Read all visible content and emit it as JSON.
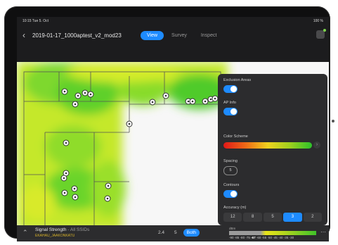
{
  "status_bar": {
    "time": "10:15  Tue 5. Oct",
    "battery": "100 %"
  },
  "nav": {
    "back_icon": "chevron-left-icon",
    "title": "2019-01-17_1000aptest_v2_mod23",
    "tabs": [
      {
        "label": "View",
        "active": true
      },
      {
        "label": "Survey",
        "active": false
      },
      {
        "label": "Inspect",
        "active": false
      }
    ],
    "menu_icon": "sidebar-icon"
  },
  "panel": {
    "exclusion_areas": {
      "label": "Exclusion Areas",
      "on": true
    },
    "ap_info": {
      "label": "AP Info",
      "on": true
    },
    "color_scheme": {
      "label": "Color Scheme",
      "colors": [
        "#e01818",
        "#ef6a17",
        "#f0d21e",
        "#9fd01e",
        "#2cc12a"
      ]
    },
    "spacing": {
      "label": "Spacing",
      "value": "5"
    },
    "contours": {
      "label": "Contours",
      "on": true
    },
    "accuracy": {
      "label": "Accuracy (m)",
      "options": [
        "12",
        "8",
        "5",
        "3",
        "2"
      ],
      "selected": "3"
    }
  },
  "bottom": {
    "title": "Signal Strength",
    "subtitle": " - All SSIDs",
    "ssid": "EKAHAU_JAAKONKATU",
    "bands": [
      {
        "label": "2.4",
        "active": false
      },
      {
        "label": "5",
        "active": false
      },
      {
        "label": "Both",
        "active": true
      }
    ],
    "scale_unit": "dBm",
    "scale_values": [
      "-90",
      "-85",
      "-80",
      "-75",
      "-67",
      "-60",
      "-55",
      "-50",
      "-45",
      "-40",
      "-35",
      "-30"
    ],
    "scale_selected": "-67",
    "more_icon": "ellipsis-icon"
  },
  "colors": {
    "accent": "#1e8bff",
    "panel_bg": "#2c2c2e",
    "strong_signal": "#2cc12a",
    "weak_signal": "#e9e419"
  }
}
